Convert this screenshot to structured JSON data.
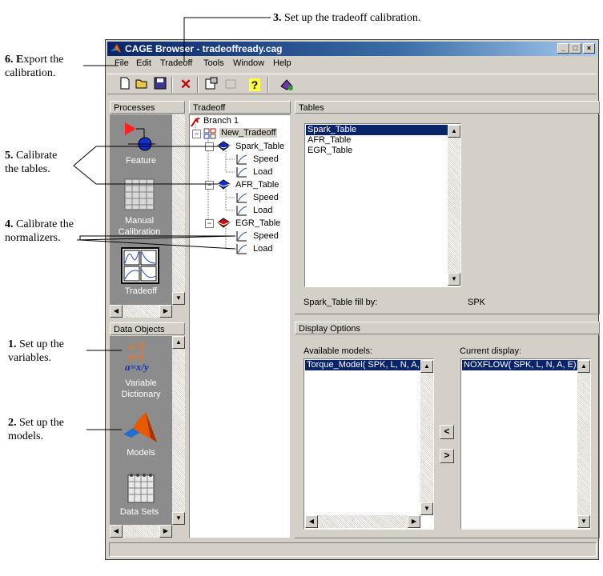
{
  "annotations": {
    "a3": {
      "num": "3.",
      "text": " Set up the tradeoff calibration."
    },
    "a6": {
      "num": "6. E",
      "text": "xport the calibration."
    },
    "a5": {
      "num": "5.",
      "text": " Calibrate the tables."
    },
    "a4": {
      "num": "4.",
      "text": " Calibrate the normalizers."
    },
    "a1": {
      "num": "1.",
      "text": " Set up the variables."
    },
    "a2": {
      "num": "2.",
      "text": " Set up the models."
    }
  },
  "window": {
    "title": "CAGE Browser - tradeoffready.cag",
    "min": "_",
    "max": "□",
    "close": "×"
  },
  "menu": [
    "File",
    "Edit",
    "Tradeoff",
    "Tools",
    "Window",
    "Help"
  ],
  "toolbar_icons": [
    "new-icon",
    "open-icon",
    "save-icon",
    "delete-icon",
    "properties-icon",
    "disabled-icon",
    "help-icon",
    "tradeoff-add-icon"
  ],
  "processes": {
    "header": "Processes",
    "items": [
      {
        "label": "Feature",
        "icon": "feature-icon"
      },
      {
        "label": "Manual Calibration",
        "icon": "manual-calibration-icon"
      },
      {
        "label": "Tradeoff",
        "icon": "tradeoff-icon"
      }
    ]
  },
  "data_objects": {
    "header": "Data Objects",
    "items": [
      {
        "label": "Variable Dictionary",
        "icon": "variable-dictionary-icon"
      },
      {
        "label": "Models",
        "icon": "models-icon"
      },
      {
        "label": "Data Sets",
        "icon": "data-sets-icon"
      }
    ]
  },
  "tradeoff_tree": {
    "header": "Tradeoff",
    "branch": "Branch 1",
    "tradeoff": "New_Tradeoff",
    "tables": [
      {
        "name": "Spark_Table",
        "color": "#0000cc",
        "normalizers": [
          "Speed",
          "Load"
        ]
      },
      {
        "name": "AFR_Table",
        "color": "#0000cc",
        "normalizers": [
          "Speed",
          "Load"
        ]
      },
      {
        "name": "EGR_Table",
        "color": "#cc0000",
        "normalizers": [
          "Speed",
          "Load"
        ]
      }
    ]
  },
  "tables_panel": {
    "header": "Tables",
    "items": [
      "Spark_Table",
      "AFR_Table",
      "EGR_Table"
    ],
    "selected": 0,
    "fill_label": "Spark_Table fill by:",
    "fill_value": "SPK"
  },
  "display_options": {
    "header": "Display Options",
    "available_label": "Available models:",
    "available": [
      "Torque_Model( SPK, L, N, A, E)"
    ],
    "current_label": "Current display:",
    "current": [
      "NOXFLOW( SPK, L, N, A, E)"
    ],
    "move_left": "<",
    "move_right": ">"
  }
}
